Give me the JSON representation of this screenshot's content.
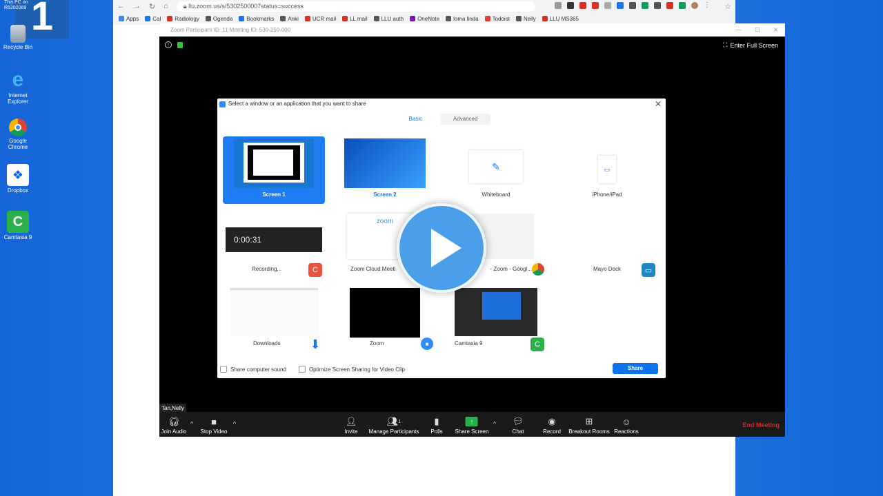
{
  "desktop": {
    "tile_number": "1",
    "this_pc": "This PC on R5202069",
    "icons": [
      {
        "label": "Recycle Bin",
        "icon": "recycle-bin-icon"
      },
      {
        "label": "Internet Explorer",
        "icon": "internet-explorer-icon"
      },
      {
        "label": "Google Chrome",
        "icon": "chrome-icon"
      },
      {
        "label": "Dropbox",
        "icon": "dropbox-icon"
      },
      {
        "label": "Camtasia 9",
        "icon": "camtasia-icon"
      }
    ]
  },
  "browser": {
    "url": "llu.zoom.us/s/5302500007status=success",
    "bookmarks": [
      {
        "label": "Apps",
        "color": "#4285f4"
      },
      {
        "label": "Cal",
        "color": "#1a73e8"
      },
      {
        "label": "Radiology",
        "color": "#d93025"
      },
      {
        "label": "Ogenda",
        "color": "#555555"
      },
      {
        "label": "Bookmarks",
        "color": "#1a73e8"
      },
      {
        "label": "Anki",
        "color": "#555555"
      },
      {
        "label": "UCR mail",
        "color": "#d93025"
      },
      {
        "label": "LL mail",
        "color": "#d93025"
      },
      {
        "label": "LLU auth",
        "color": "#555555"
      },
      {
        "label": "OneNote",
        "color": "#7719aa"
      },
      {
        "label": "loma linda",
        "color": "#555555"
      },
      {
        "label": "Todoist",
        "color": "#db4035"
      },
      {
        "label": "Nelly",
        "color": "#555555"
      },
      {
        "label": "LLU MS365",
        "color": "#d93025"
      }
    ]
  },
  "zoom": {
    "window_title": "Zoom Participant ID: 11   Meeting ID: 530-250-000",
    "enter_full_screen": "Enter Full Screen",
    "participant_name": "Tan,Nelly",
    "end_meeting": "End Meeting",
    "toolbar": {
      "join_audio": "Join Audio",
      "stop_video": "Stop Video",
      "invite": "Invite",
      "manage_participants": "Manage Participants",
      "participant_count": "1",
      "polls": "Polls",
      "share_screen": "Share Screen",
      "chat": "Chat",
      "record": "Record",
      "breakout_rooms": "Breakout Rooms",
      "reactions": "Reactions"
    }
  },
  "dialog": {
    "title": "Select a window or an application that you want to share",
    "tabs": {
      "basic": "Basic",
      "advanced": "Advanced"
    },
    "items": [
      {
        "label": "Screen 1"
      },
      {
        "label": "Screen 2"
      },
      {
        "label": "Whiteboard"
      },
      {
        "label": "iPhone/iPad"
      },
      {
        "label": "Recording..."
      },
      {
        "label": "Zoom Cloud Meeti"
      },
      {
        "label": "- Zoom - Googl..."
      },
      {
        "label": "Mayo Dock"
      },
      {
        "label": "Downloads"
      },
      {
        "label": "Zoom"
      },
      {
        "label": "Camtasia 9"
      }
    ],
    "timer": "0:00:31",
    "zoom_logo_text": "zoom",
    "share_sound": "Share computer sound",
    "optimize": "Optimize Screen Sharing for Video Clip",
    "share_button": "Share"
  }
}
